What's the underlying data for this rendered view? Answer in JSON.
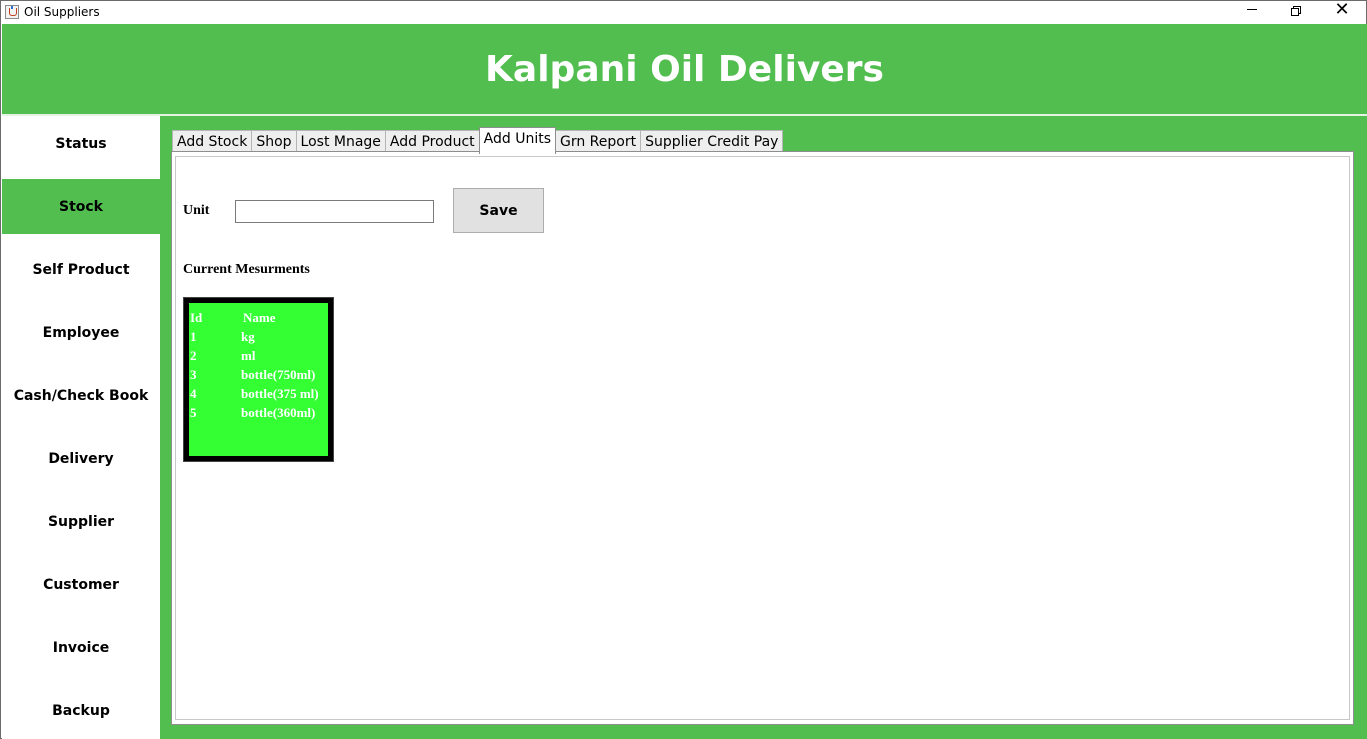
{
  "window": {
    "title": "Oil Suppliers"
  },
  "header": {
    "title": "Kalpani Oil Delivers"
  },
  "sidebar": {
    "items": [
      {
        "label": "Status"
      },
      {
        "label": "Stock"
      },
      {
        "label": "Self Product"
      },
      {
        "label": "Employee"
      },
      {
        "label": "Cash/Check Book"
      },
      {
        "label": "Delivery"
      },
      {
        "label": "Supplier"
      },
      {
        "label": "Customer"
      },
      {
        "label": "Invoice"
      },
      {
        "label": "Backup"
      }
    ],
    "active": "Stock"
  },
  "tabs": [
    {
      "label": "Add Stock"
    },
    {
      "label": "Shop"
    },
    {
      "label": "Lost Mnage"
    },
    {
      "label": "Add Product"
    },
    {
      "label": "Add Units"
    },
    {
      "label": "Grn Report"
    },
    {
      "label": "Supplier Credit Pay"
    }
  ],
  "active_tab": "Add Units",
  "form": {
    "unit_label": "Unit",
    "unit_value": "",
    "save_label": "Save",
    "current_label": "Current Mesurments"
  },
  "units_table": {
    "headers": [
      "Id",
      "Name"
    ],
    "rows": [
      [
        "1",
        "kg"
      ],
      [
        "2",
        "ml"
      ],
      [
        "3",
        "bottle(750ml)"
      ],
      [
        "4",
        "bottle(375 ml)"
      ],
      [
        "5",
        "bottle(360ml)"
      ]
    ]
  },
  "colors": {
    "brand_green": "#52be50",
    "table_green": "#33ff33"
  },
  "icons": {
    "app": "java-cup-icon",
    "minimize": "minimize-icon",
    "maximize": "restore-icon",
    "close": "close-icon"
  }
}
